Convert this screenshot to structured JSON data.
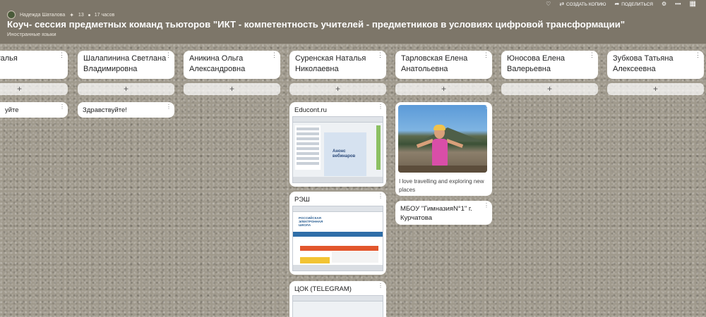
{
  "header": {
    "author": "Надежда Шаталова",
    "likes": "13",
    "time": "17 часов",
    "title": "Коуч- сессия предметных команд тьюторов \"ИКТ - компетентность учителей - предметников в условиях цифровой трансформации\"",
    "subtitle": "Иностранные языки",
    "actions": {
      "copy_label": "СОЗДАТЬ КОПИЮ",
      "share_label": "ПОДЕЛИТЬСЯ"
    }
  },
  "icons": {
    "heart": "♡",
    "copy": "⇄",
    "share": "➦",
    "settings": "⚙",
    "more": "•••",
    "apps": "▦",
    "kebab": "⋮",
    "plus": "+"
  },
  "columns": [
    {
      "title": "ва Наталья\nвна"
    },
    {
      "title": "Шалапинина Светлана Владимировна"
    },
    {
      "title": "Аникина Ольга Александровна"
    },
    {
      "title": "Суренская Наталья Николаевна"
    },
    {
      "title": "Тарловская Елена Анатольевна"
    },
    {
      "title": "Юносова Елена Валерьевна"
    },
    {
      "title": "Зубкова Татьяна Алексеевна"
    }
  ],
  "cards": {
    "c0_note": "уйте",
    "c1_note": "Здравствуйте!",
    "educont_title": "Educont.ru",
    "educont_promo": "Анонс вебинаров",
    "resh_title": "РЭШ",
    "resh_logo": "РОССИЙСКАЯ ЭЛЕКТРОННАЯ ШКОЛА",
    "tsok_title": "ЦОК (TELEGRAM)",
    "photo_caption": "I love travelling and exploring new places",
    "school_title": "МБОУ \"ГимназияN°1\" г. Курчатова"
  }
}
